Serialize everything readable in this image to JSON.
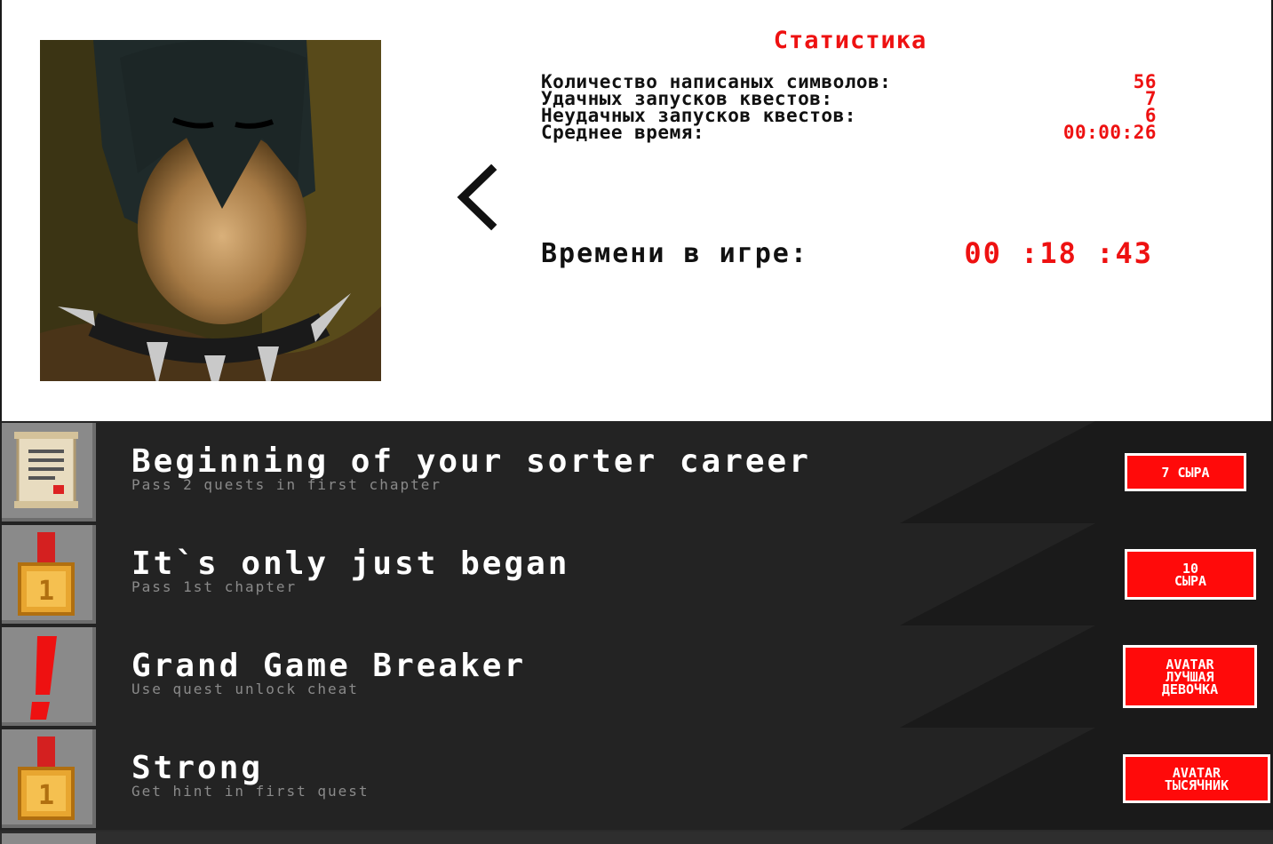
{
  "stats": {
    "title": "Статистика",
    "rows": [
      {
        "label": "Количество написаных символов:",
        "value": "56"
      },
      {
        "label": "Удачных запусков квестов:",
        "value": "7"
      },
      {
        "label": "Неудачных запусков квестов:",
        "value": "6"
      },
      {
        "label": "Среднее время:",
        "value": "00:00:26"
      }
    ],
    "playtime_label": "Времени в игре:",
    "playtime_value": "00 :18 :43"
  },
  "achievements": [
    {
      "title": "Beginning of your sorter career",
      "desc": "Pass 2 quests in first chapter",
      "reward": "7 СЫРА",
      "icon": "scroll-icon"
    },
    {
      "title": "It`s only just began",
      "desc": "Pass 1st chapter",
      "reward": "10\nСЫРА",
      "icon": "medal-icon"
    },
    {
      "title": "Grand Game Breaker",
      "desc": "Use quest unlock cheat",
      "reward": "AVATAR\nЛУЧШАЯ\nДЕВОЧКА",
      "icon": "exclamation-icon"
    },
    {
      "title": "Strong",
      "desc": "Get hint in first quest",
      "reward": "AVATAR\nТЫСЯЧНИК",
      "icon": "medal-icon"
    }
  ],
  "colors": {
    "accent_red": "#ff0a0a",
    "panel_dark": "#232323",
    "icon_bg": "#8a8a8a"
  }
}
